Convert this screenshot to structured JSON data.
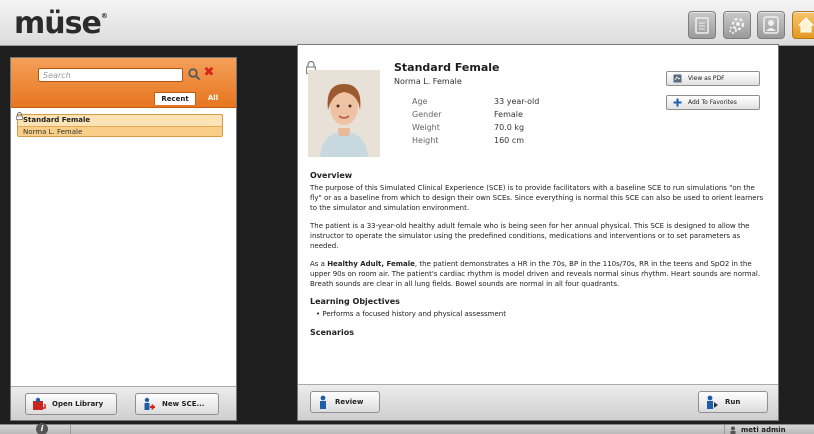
{
  "header": {
    "logo_text": "müse",
    "logo_mark": "®",
    "buttons": [
      {
        "name": "library-icon"
      },
      {
        "name": "settings-icon"
      },
      {
        "name": "user-icon"
      },
      {
        "name": "home-icon"
      }
    ]
  },
  "sidebar": {
    "search_placeholder": "Search",
    "tabs": [
      "Recent",
      "All"
    ],
    "selected_tab": "Recent",
    "list": {
      "title": "Standard Female",
      "patient": "Norma L. Female"
    },
    "buttons": {
      "open_library": "Open Library",
      "new_sce": "New SCE..."
    }
  },
  "detail": {
    "title": "Standard Female",
    "patient": "Norma L. Female",
    "stats": [
      {
        "label": "Age",
        "value": "33 year-old"
      },
      {
        "label": "Gender",
        "value": "Female"
      },
      {
        "label": "Weight",
        "value": "70.0 kg"
      },
      {
        "label": "Height",
        "value": "160 cm"
      }
    ],
    "view_pdf": "View as PDF",
    "add_favorites": "Add To Favorites",
    "overview_heading": "Overview",
    "overview_p1": "The purpose of this Simulated Clinical Experience (SCE) is to provide facilitators with a baseline SCE to run simulations \"on the fly\" or as a baseline from which to design their own SCEs. Since everything is normal this SCE can also be used to orient learners to the simulator and simulation environment.",
    "overview_p2": "The patient is a 33-year-old healthy adult female who is being seen for her annual physical. This SCE is designed to allow the instructor to operate the simulator using the predefined conditions, medications and interventions or to set parameters as needed.",
    "overview_p3_prefix": "As a ",
    "overview_p3_bold": "Healthy Adult, Female",
    "overview_p3_rest": ", the patient demonstrates a HR in the 70s, BP in the 110s/70s, RR in the teens and SpO2 in the upper 90s on room air. The patient's cardiac rhythm is model driven and reveals normal sinus rhythm. Heart sounds are normal. Breath sounds are clear in all lung fields. Bowel sounds are normal in all four quadrants.",
    "objectives_heading": "Learning Objectives",
    "objectives": [
      "Performs a focused history and physical assessment"
    ],
    "scenarios_heading": "Scenarios",
    "review_button": "Review",
    "run_button": "Run"
  },
  "statusbar": {
    "info_icon": "i",
    "user": "meti admin"
  },
  "colors": {
    "accent_orange": "#e7761f",
    "selection": "#fce3b6",
    "clear_red": "#d8231a",
    "button_blue": "#1c5fa8"
  }
}
